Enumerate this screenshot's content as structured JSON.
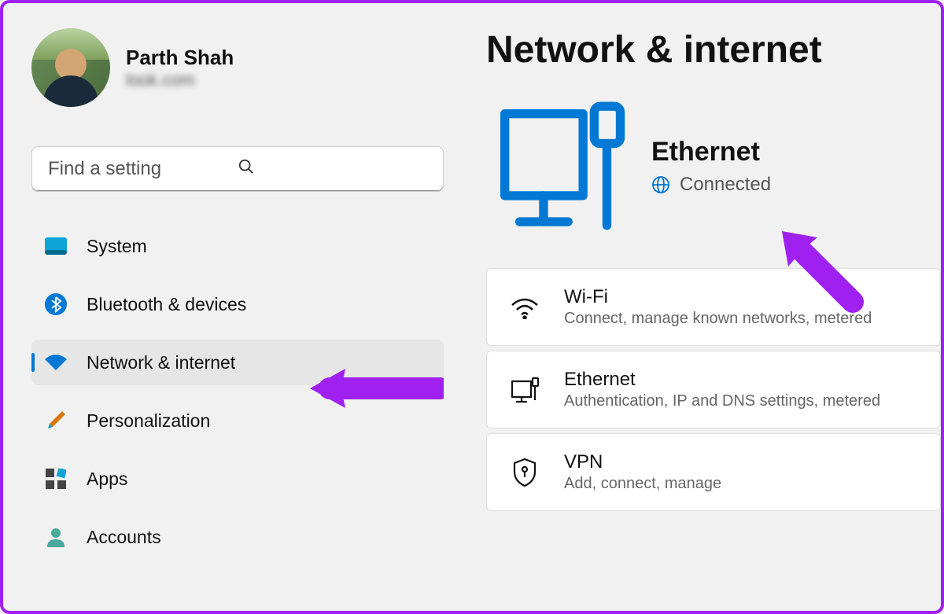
{
  "profile": {
    "name": "Parth Shah",
    "email": "look.com"
  },
  "search": {
    "placeholder": "Find a setting"
  },
  "nav": {
    "items": [
      {
        "label": "System"
      },
      {
        "label": "Bluetooth & devices"
      },
      {
        "label": "Network & internet",
        "selected": true
      },
      {
        "label": "Personalization"
      },
      {
        "label": "Apps"
      },
      {
        "label": "Accounts"
      }
    ]
  },
  "main": {
    "title": "Network & internet",
    "status": {
      "title": "Ethernet",
      "subtitle": "Connected"
    },
    "cards": [
      {
        "title": "Wi-Fi",
        "subtitle": "Connect, manage known networks, metered"
      },
      {
        "title": "Ethernet",
        "subtitle": "Authentication, IP and DNS settings, metered"
      },
      {
        "title": "VPN",
        "subtitle": "Add, connect, manage"
      }
    ]
  },
  "colors": {
    "accent": "#0078d4",
    "annotation": "#a020f0"
  }
}
